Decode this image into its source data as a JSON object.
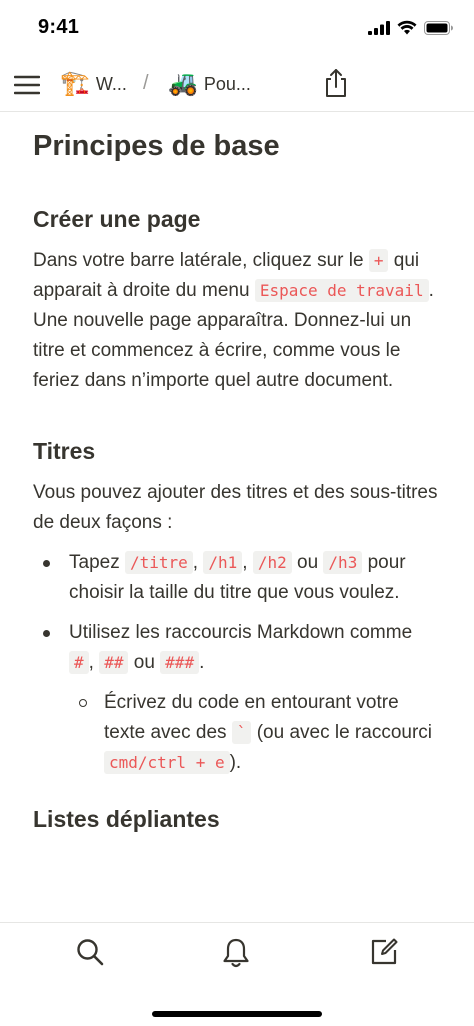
{
  "status": {
    "time": "9:41"
  },
  "nav": {
    "crumb1": {
      "emoji": "🏗️",
      "label": "W..."
    },
    "separator": "/",
    "crumb2": {
      "emoji": "🚜",
      "label": "Pou..."
    }
  },
  "page": {
    "title": "Principes de base",
    "section1": {
      "heading": "Créer une page",
      "p1": "Dans votre barre latérale, cliquez sur le ",
      "code_plus": "+",
      "p2": " qui apparait à droite du menu ",
      "code_workspace": "Espace de travail",
      "p3": ". Une nouvelle page apparaîtra. Donnez-lui un titre et commencez à écrire, comme vous le feriez dans n’importe quel autre document."
    },
    "section2": {
      "heading": "Titres",
      "intro": "Vous pouvez ajouter des titres et des sous-titres de deux façons :",
      "b1_t1": "Tapez ",
      "b1_c1": "/titre",
      "b1_s1": ", ",
      "b1_c2": "/h1",
      "b1_s2": ", ",
      "b1_c3": "/h2",
      "b1_s3": " ou ",
      "b1_c4": "/h3",
      "b1_t2": " pour choisir la taille du titre que vous voulez.",
      "b2_t1": "Utilisez les raccourcis Markdown comme ",
      "b2_c1": "#",
      "b2_s1": ", ",
      "b2_c2": "##",
      "b2_s2": " ou ",
      "b2_c3": "###",
      "b2_t2": ".",
      "sub_t1": "Écrivez du code en entourant votre texte avec des ",
      "sub_c1": "`",
      "sub_t2": " (ou avec le raccourci ",
      "sub_c2": "cmd/ctrl + e",
      "sub_t3": ")."
    },
    "section3": {
      "heading": "Listes dépliantes"
    }
  },
  "icons": {
    "menu": "hamburger-icon",
    "share": "share-icon",
    "search": "search-icon",
    "notifications": "bell-icon",
    "compose": "compose-icon"
  }
}
